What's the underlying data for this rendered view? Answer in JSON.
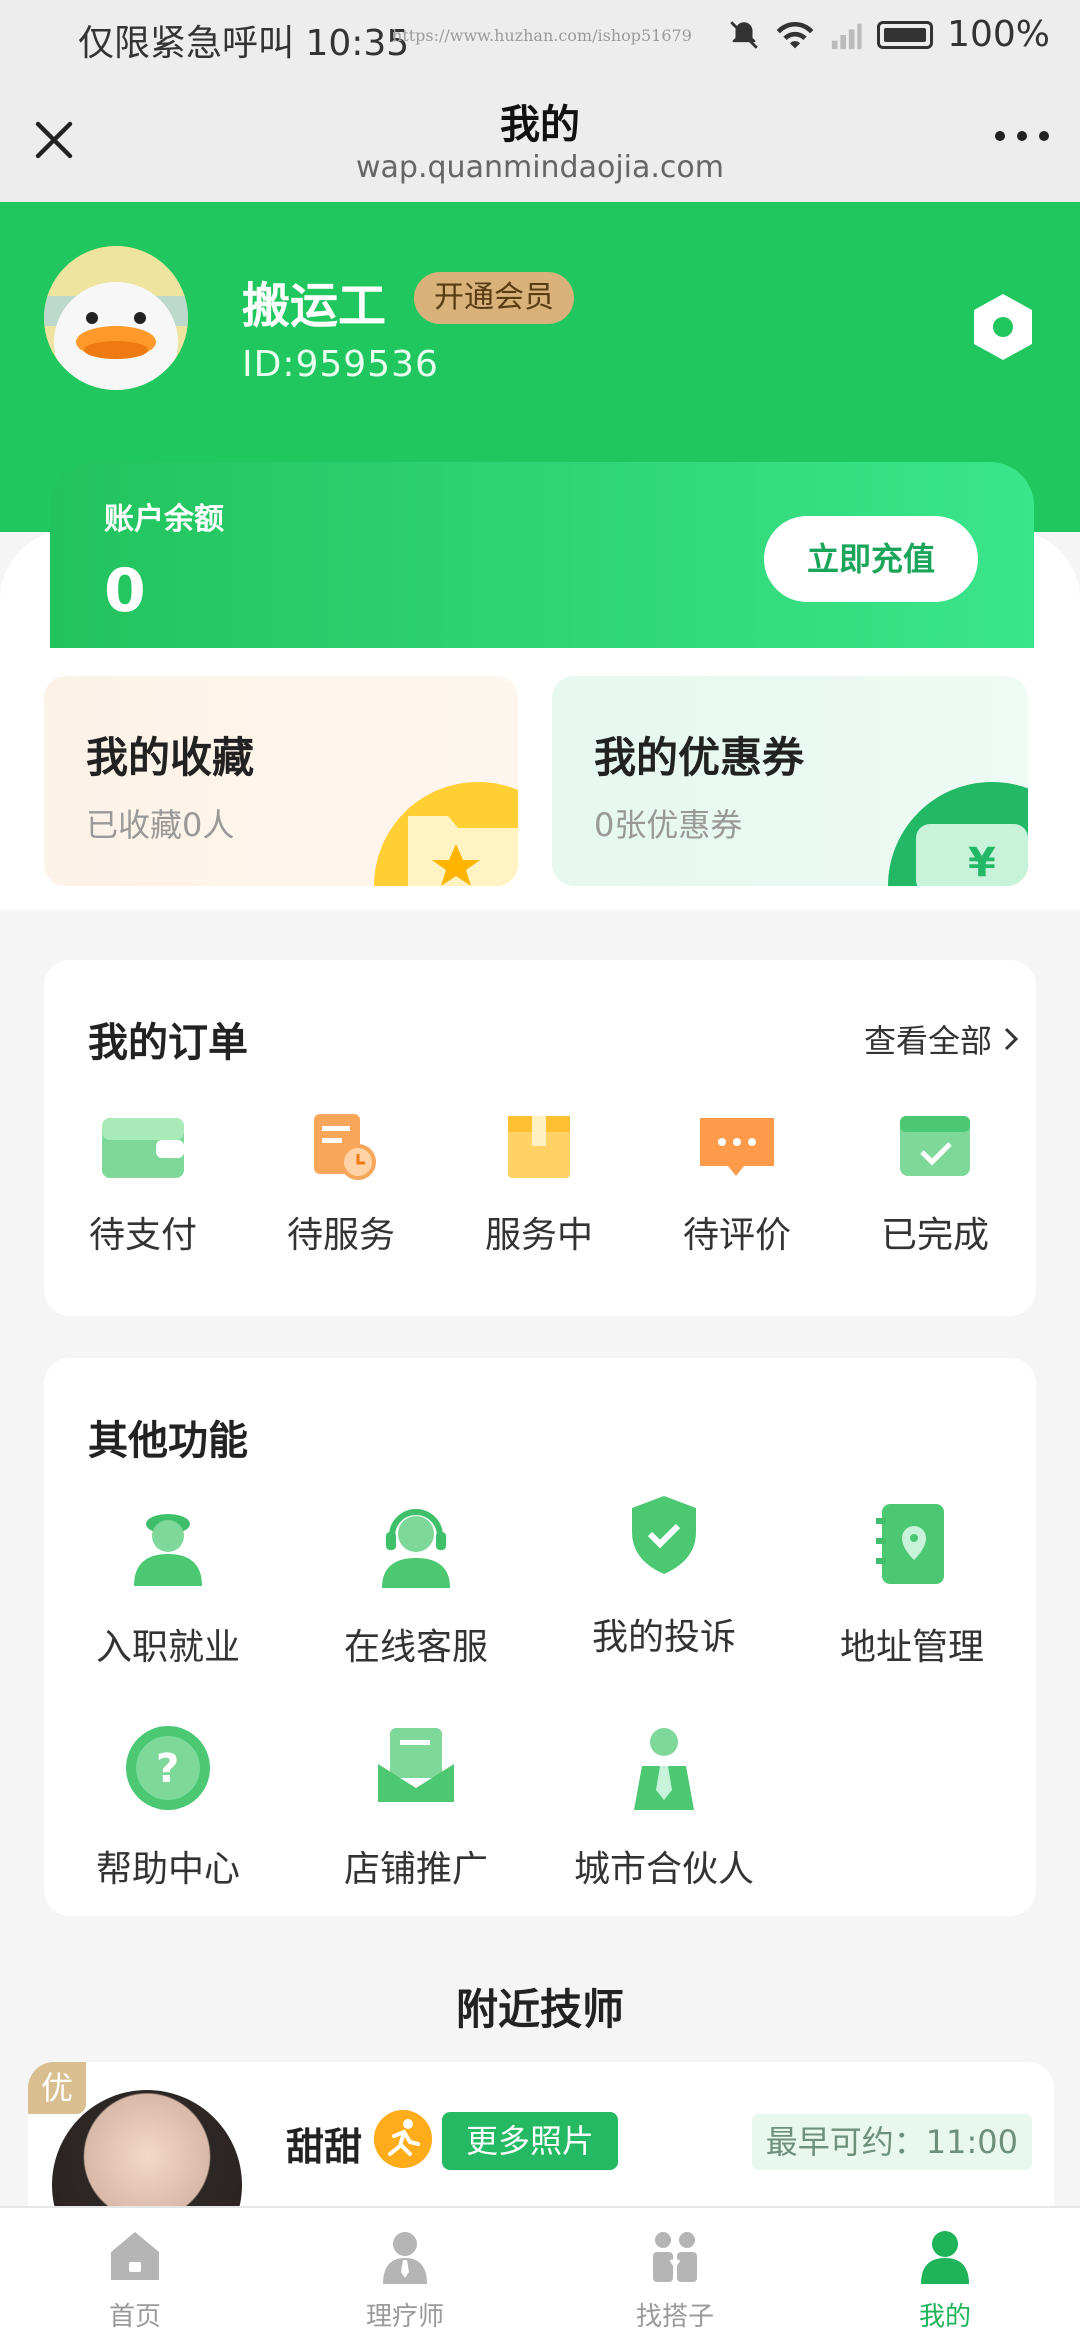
{
  "status_bar": {
    "left_text": "仅限紧急呼叫 10:35",
    "url_watermark": "https://www.huzhan.com/ishop51679",
    "battery": "100%"
  },
  "title_bar": {
    "title": "我的",
    "url": "wap.quanmindaojia.com"
  },
  "profile": {
    "name": "搬运工",
    "vip_label": "开通会员",
    "id_text": "ID:959536"
  },
  "balance": {
    "label": "账户余额",
    "value": "0",
    "recharge_label": "立即充值"
  },
  "quick_cards": {
    "favorites": {
      "title": "我的收藏",
      "subtitle": "已收藏0人"
    },
    "coupons": {
      "title": "我的优惠券",
      "subtitle": "0张优惠券"
    }
  },
  "orders": {
    "title": "我的订单",
    "see_all": "查看全部",
    "items": [
      {
        "label": "待支付",
        "icon": "wallet-icon"
      },
      {
        "label": "待服务",
        "icon": "schedule-icon"
      },
      {
        "label": "服务中",
        "icon": "box-icon"
      },
      {
        "label": "待评价",
        "icon": "comment-icon"
      },
      {
        "label": "已完成",
        "icon": "completed-icon"
      }
    ]
  },
  "other_functions": {
    "title": "其他功能",
    "items": [
      {
        "label": "入职就业",
        "icon": "worker-icon"
      },
      {
        "label": "在线客服",
        "icon": "headset-icon"
      },
      {
        "label": "我的投诉",
        "icon": "shield-check-icon"
      },
      {
        "label": "地址管理",
        "icon": "address-book-icon"
      },
      {
        "label": "帮助中心",
        "icon": "help-icon"
      },
      {
        "label": "店铺推广",
        "icon": "mail-icon"
      },
      {
        "label": "城市合伙人",
        "icon": "partner-icon"
      }
    ]
  },
  "nearby": {
    "title": "附近技师",
    "technician": {
      "tag": "优",
      "name": "甜甜",
      "more_photos": "更多照片",
      "earliest": "最早可约：11:00"
    }
  },
  "tabbar": {
    "items": [
      {
        "label": "首页",
        "icon": "home-icon"
      },
      {
        "label": "理疗师",
        "icon": "therapist-icon"
      },
      {
        "label": "找搭子",
        "icon": "partner-find-icon"
      },
      {
        "label": "我的",
        "icon": "profile-icon"
      }
    ],
    "active_index": 3
  },
  "colors": {
    "brand_green": "#1fc75e",
    "vip_gold": "#d8b27a"
  }
}
